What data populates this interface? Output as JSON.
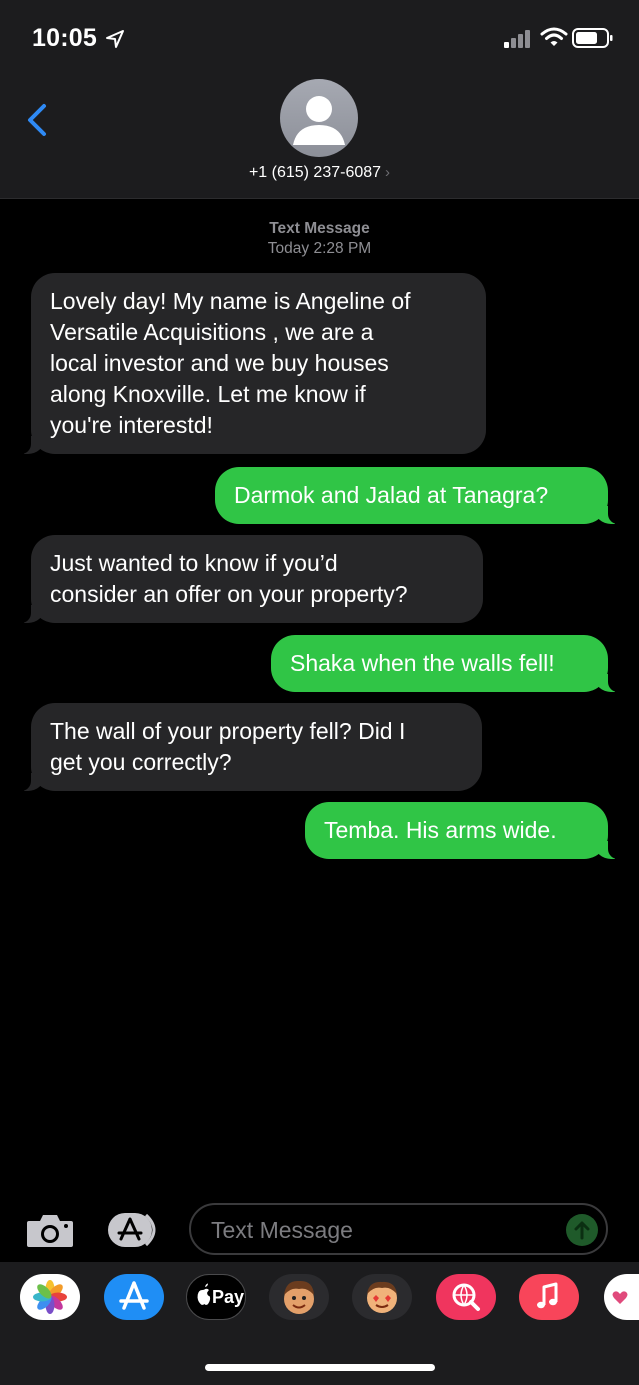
{
  "status": {
    "time": "10:05"
  },
  "header": {
    "contact": "+1 (615) 237-6087"
  },
  "timestamp": {
    "label": "Text Message",
    "time": "Today 2:28 PM"
  },
  "messages": [
    {
      "from": "them",
      "text": "Lovely day! My name is Angeline of\nVersatile Acquisitions , we are a\nlocal investor and we buy houses\nalong Knoxville. Let me know if\nyou're interestd!"
    },
    {
      "from": "me",
      "text": "Darmok and Jalad at Tanagra?"
    },
    {
      "from": "them",
      "text": "Just wanted to know if you’d\nconsider an offer on your property?"
    },
    {
      "from": "me",
      "text": "Shaka when the walls fell!"
    },
    {
      "from": "them",
      "text": "The wall of your property fell? Did I\nget you correctly?"
    },
    {
      "from": "me",
      "text": "Temba. His arms wide."
    }
  ],
  "composer": {
    "placeholder": "Text Message"
  },
  "apps": [
    {
      "name": "photos-app-icon"
    },
    {
      "name": "app-store-icon"
    },
    {
      "name": "apple-pay-icon",
      "label": "Pay"
    },
    {
      "name": "memoji-icon"
    },
    {
      "name": "animoji-stickers-icon"
    },
    {
      "name": "web-search-icon"
    },
    {
      "name": "music-icon"
    }
  ],
  "colors": {
    "sent": "#30c546",
    "received": "#262628",
    "accent": "#2f8af5"
  }
}
